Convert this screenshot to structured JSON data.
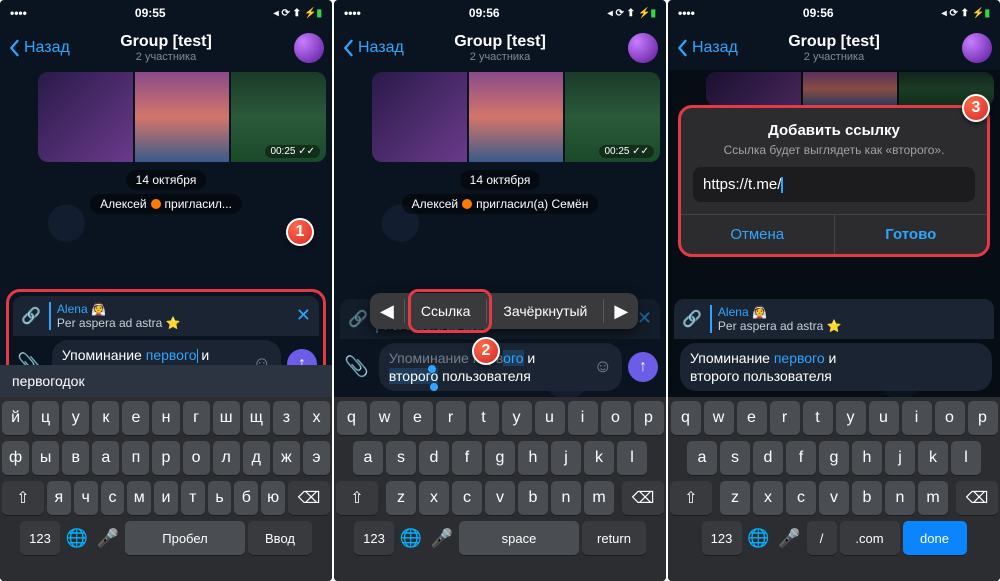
{
  "status": {
    "time1": "09:55",
    "time2": "09:56",
    "time3": "09:56",
    "signal_icons": "◂ ⟳ ⬆ ⚡"
  },
  "nav": {
    "back": "Назад",
    "title": "Group [test]",
    "subtitle": "2 участника"
  },
  "media": {
    "stamp": "00:25 ✓✓"
  },
  "date": "14 октября",
  "system_msg": {
    "p1a": "Алексей",
    "p1b": "пригласил...",
    "p2b": "пригласил(а) Семён"
  },
  "reply": {
    "name": "Alena 👰",
    "text_pre": "Per aspera ad astra ",
    "text": "Per aspera ad astra ⭐"
  },
  "compose": {
    "line1_pre": "Упоминание ",
    "mention": "первого",
    "line1_post": " и",
    "line2": "второго пользователя",
    "line1_p3_post": " и"
  },
  "suggest": "первогодок",
  "ctx": {
    "arrow_l": "◀",
    "link": "Ссылка",
    "strike": "Зачёркнутый",
    "arrow_r": "▶"
  },
  "dialog": {
    "title": "Добавить ссылку",
    "sub": "Ссылка будет выглядеть как «второго».",
    "value": "https://t.me/",
    "cancel": "Отмена",
    "ok": "Готово"
  },
  "keys_ru": {
    "r1": [
      "й",
      "ц",
      "у",
      "к",
      "е",
      "н",
      "г",
      "ш",
      "щ",
      "з",
      "х"
    ],
    "r2": [
      "ф",
      "ы",
      "в",
      "а",
      "п",
      "р",
      "о",
      "л",
      "д",
      "ж",
      "э"
    ],
    "r3_mid": [
      "я",
      "ч",
      "с",
      "м",
      "и",
      "т",
      "ь",
      "б",
      "ю"
    ],
    "shift": "⇧",
    "bksp": "⌫",
    "k123": "123",
    "globe": "🌐",
    "mic": "🎤",
    "space": "Пробел",
    "ret": "Ввод"
  },
  "keys_en": {
    "r1": [
      "q",
      "w",
      "e",
      "r",
      "t",
      "y",
      "u",
      "i",
      "o",
      "p"
    ],
    "r2": [
      "a",
      "s",
      "d",
      "f",
      "g",
      "h",
      "j",
      "k",
      "l"
    ],
    "r3_mid": [
      "z",
      "x",
      "c",
      "v",
      "b",
      "n",
      "m"
    ],
    "shift": "⇧",
    "bksp": "⌫",
    "k123": "123",
    "globe": "🌐",
    "mic": "🎤",
    "space": "space",
    "ret": "return"
  },
  "keys_url": {
    "r1": [
      "q",
      "w",
      "e",
      "r",
      "t",
      "y",
      "u",
      "i",
      "o",
      "p"
    ],
    "r2": [
      "a",
      "s",
      "d",
      "f",
      "g",
      "h",
      "j",
      "k",
      "l"
    ],
    "r3_mid": [
      "z",
      "x",
      "c",
      "v",
      "b",
      "n",
      "m"
    ],
    "shift": "⇧",
    "bksp": "⌫",
    "k123": "123",
    "globe": "🌐",
    "mic": "🎤",
    "slash": "/",
    "dotcom": ".com",
    "done": "done"
  },
  "badges": {
    "b1": "1",
    "b2": "2",
    "b3": "3"
  },
  "timestamp_side": "00:25 ✓✓"
}
